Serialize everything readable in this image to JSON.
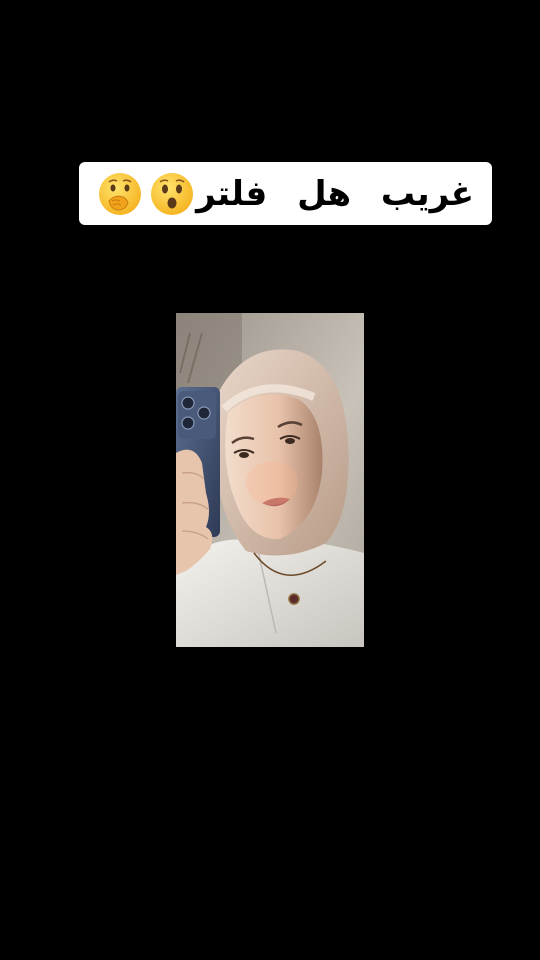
{
  "caption": {
    "text": "غريب  هل  فلتر",
    "emojis": [
      "astonished-face",
      "face-with-hand-over-mouth"
    ]
  },
  "video": {
    "subject": "selfie-photo"
  },
  "colors": {
    "background": "#000000",
    "caption_background": "#ffffff",
    "caption_text": "#000000"
  }
}
